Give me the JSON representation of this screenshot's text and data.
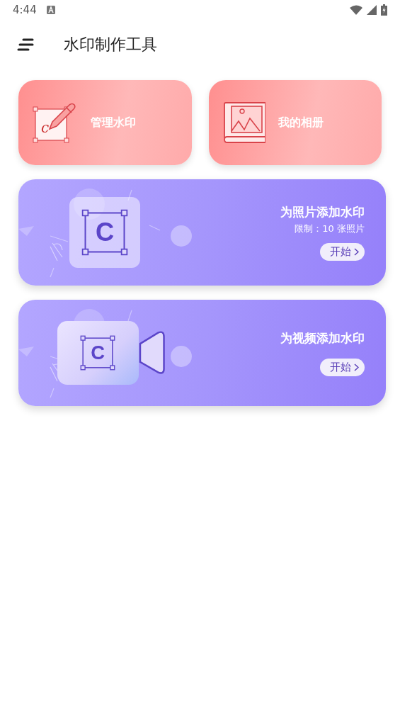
{
  "status_bar": {
    "time": "4:44"
  },
  "header": {
    "title": "水印制作工具"
  },
  "quick_cards": [
    {
      "kind": "edit",
      "label": "管理水印",
      "icon_letter": "c"
    },
    {
      "kind": "album",
      "label": "我的相册"
    }
  ],
  "banners": [
    {
      "kind": "photo",
      "title": "为照片添加水印",
      "subtitle": "限制：10 张照片",
      "icon_letter": "C",
      "button": "开始"
    },
    {
      "kind": "video",
      "title": "为视频添加水印",
      "icon_letter": "C",
      "button": "开始"
    }
  ]
}
